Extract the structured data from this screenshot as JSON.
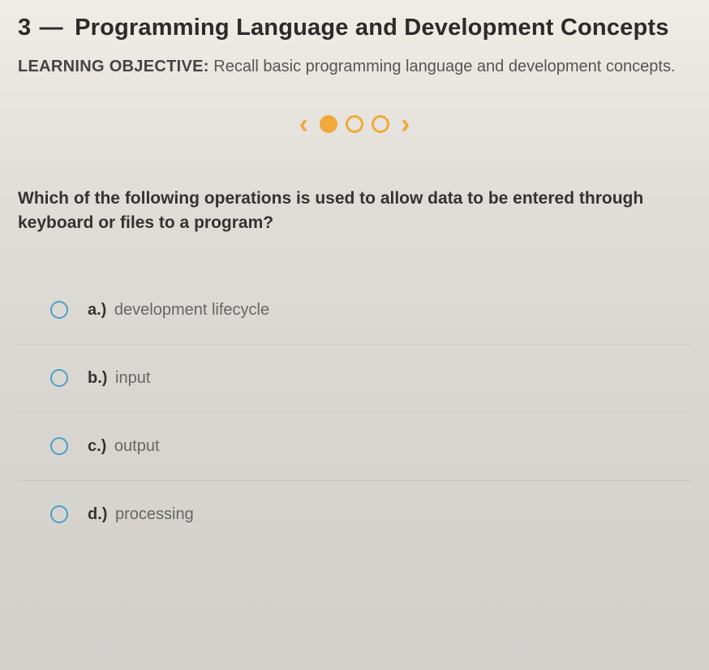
{
  "header": {
    "number": "3",
    "dash": "—",
    "title": "Programming Language and Development Concepts"
  },
  "objective": {
    "label": "LEARNING OBJECTIVE:",
    "text": "Recall basic programming language and development concepts."
  },
  "pager": {
    "prev": "‹",
    "next": "›",
    "dots": [
      true,
      false,
      false
    ]
  },
  "question": "Which of the following operations is used to allow data to be entered through keyboard or files to a program?",
  "options": [
    {
      "letter": "a.)",
      "text": "development lifecycle"
    },
    {
      "letter": "b.)",
      "text": "input"
    },
    {
      "letter": "c.)",
      "text": "output"
    },
    {
      "letter": "d.)",
      "text": "processing"
    }
  ]
}
